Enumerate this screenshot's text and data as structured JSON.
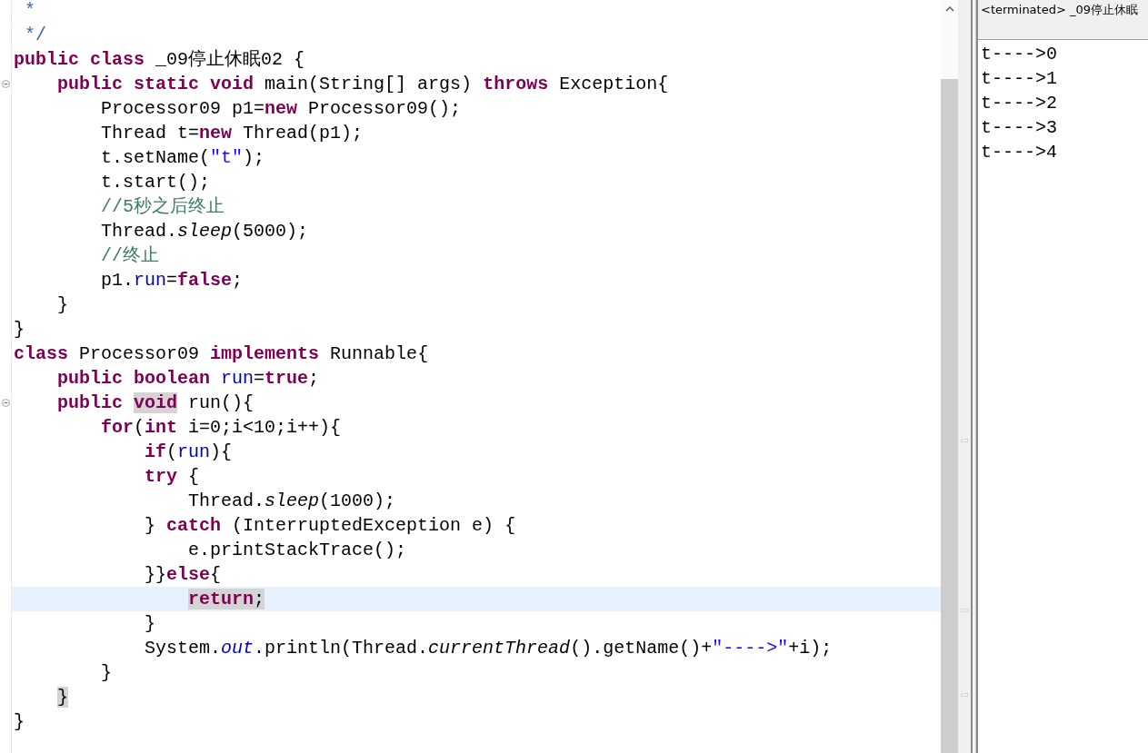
{
  "editor": {
    "lines": [
      {
        "fold_marker": false,
        "current": false,
        "tokens": [
          {
            "kind": "javadoc",
            "text": " *"
          }
        ]
      },
      {
        "fold_marker": false,
        "current": false,
        "tokens": [
          {
            "kind": "javadoc",
            "text": " */"
          }
        ]
      },
      {
        "fold_marker": false,
        "current": false,
        "tokens": [
          {
            "kind": "keyword",
            "text": "public class"
          },
          {
            "kind": "plain",
            "text": " _09停止休眠02 {"
          }
        ]
      },
      {
        "fold_marker": true,
        "current": false,
        "tokens": [
          {
            "kind": "keyword",
            "text": "    public static void"
          },
          {
            "kind": "plain",
            "text": " main(String[] args) "
          },
          {
            "kind": "keyword",
            "text": "throws"
          },
          {
            "kind": "plain",
            "text": " Exception{"
          }
        ]
      },
      {
        "fold_marker": false,
        "current": false,
        "tokens": [
          {
            "kind": "plain",
            "text": "        Processor09 p1="
          },
          {
            "kind": "keyword",
            "text": "new"
          },
          {
            "kind": "plain",
            "text": " Processor09();"
          }
        ]
      },
      {
        "fold_marker": false,
        "current": false,
        "tokens": [
          {
            "kind": "plain",
            "text": "        Thread t="
          },
          {
            "kind": "keyword",
            "text": "new"
          },
          {
            "kind": "plain",
            "text": " Thread(p1);"
          }
        ]
      },
      {
        "fold_marker": false,
        "current": false,
        "tokens": [
          {
            "kind": "plain",
            "text": "        t.setName("
          },
          {
            "kind": "string",
            "text": "\"t\""
          },
          {
            "kind": "plain",
            "text": ");"
          }
        ]
      },
      {
        "fold_marker": false,
        "current": false,
        "tokens": [
          {
            "kind": "plain",
            "text": "        t.start();"
          }
        ]
      },
      {
        "fold_marker": false,
        "current": false,
        "tokens": [
          {
            "kind": "comment",
            "text": "        //5秒之后终止"
          }
        ]
      },
      {
        "fold_marker": false,
        "current": false,
        "tokens": [
          {
            "kind": "plain",
            "text": "        Thread."
          },
          {
            "kind": "static-method",
            "text": "sleep"
          },
          {
            "kind": "plain",
            "text": "(5000);"
          }
        ]
      },
      {
        "fold_marker": false,
        "current": false,
        "tokens": [
          {
            "kind": "comment",
            "text": "        //终止"
          }
        ]
      },
      {
        "fold_marker": false,
        "current": false,
        "tokens": [
          {
            "kind": "plain",
            "text": "        p1."
          },
          {
            "kind": "field",
            "text": "run"
          },
          {
            "kind": "plain",
            "text": "="
          },
          {
            "kind": "keyword",
            "text": "false"
          },
          {
            "kind": "plain",
            "text": ";"
          }
        ]
      },
      {
        "fold_marker": false,
        "current": false,
        "tokens": [
          {
            "kind": "plain",
            "text": "    }"
          }
        ]
      },
      {
        "fold_marker": false,
        "current": false,
        "tokens": [
          {
            "kind": "plain",
            "text": "}"
          }
        ]
      },
      {
        "fold_marker": false,
        "current": false,
        "tokens": [
          {
            "kind": "keyword",
            "text": "class"
          },
          {
            "kind": "plain",
            "text": " Processor09 "
          },
          {
            "kind": "keyword",
            "text": "implements"
          },
          {
            "kind": "plain",
            "text": " Runnable{"
          }
        ]
      },
      {
        "fold_marker": false,
        "current": false,
        "tokens": [
          {
            "kind": "keyword",
            "text": "    public boolean "
          },
          {
            "kind": "field",
            "text": "run"
          },
          {
            "kind": "plain",
            "text": "="
          },
          {
            "kind": "keyword",
            "text": "true"
          },
          {
            "kind": "plain",
            "text": ";"
          }
        ]
      },
      {
        "fold_marker": true,
        "current": false,
        "tokens": [
          {
            "kind": "keyword",
            "text": "    public "
          },
          {
            "kind": "marked-keyword",
            "text": "void"
          },
          {
            "kind": "plain",
            "text": " run(){"
          }
        ]
      },
      {
        "fold_marker": false,
        "current": false,
        "tokens": [
          {
            "kind": "keyword",
            "text": "        for"
          },
          {
            "kind": "plain",
            "text": "("
          },
          {
            "kind": "keyword",
            "text": "int"
          },
          {
            "kind": "plain",
            "text": " i=0;i<10;i++){"
          }
        ]
      },
      {
        "fold_marker": false,
        "current": false,
        "tokens": [
          {
            "kind": "keyword",
            "text": "            if"
          },
          {
            "kind": "plain",
            "text": "("
          },
          {
            "kind": "field",
            "text": "run"
          },
          {
            "kind": "plain",
            "text": "){"
          }
        ]
      },
      {
        "fold_marker": false,
        "current": false,
        "tokens": [
          {
            "kind": "keyword",
            "text": "            try"
          },
          {
            "kind": "plain",
            "text": " {"
          }
        ]
      },
      {
        "fold_marker": false,
        "current": false,
        "tokens": [
          {
            "kind": "plain",
            "text": "                Thread."
          },
          {
            "kind": "static-method",
            "text": "sleep"
          },
          {
            "kind": "plain",
            "text": "(1000);"
          }
        ]
      },
      {
        "fold_marker": false,
        "current": false,
        "tokens": [
          {
            "kind": "plain",
            "text": "            } "
          },
          {
            "kind": "keyword",
            "text": "catch"
          },
          {
            "kind": "plain",
            "text": " (InterruptedException e) {"
          }
        ]
      },
      {
        "fold_marker": false,
        "current": false,
        "tokens": [
          {
            "kind": "plain",
            "text": "                e.printStackTrace();"
          }
        ]
      },
      {
        "fold_marker": false,
        "current": false,
        "tokens": [
          {
            "kind": "plain",
            "text": "            }}"
          },
          {
            "kind": "keyword",
            "text": "else"
          },
          {
            "kind": "plain",
            "text": "{"
          }
        ]
      },
      {
        "fold_marker": false,
        "current": true,
        "tokens": [
          {
            "kind": "marked-keyword",
            "text": "                return"
          },
          {
            "kind": "marked-plain",
            "text": ";"
          }
        ]
      },
      {
        "fold_marker": false,
        "current": false,
        "tokens": [
          {
            "kind": "plain",
            "text": "            }"
          }
        ]
      },
      {
        "fold_marker": false,
        "current": false,
        "tokens": [
          {
            "kind": "plain",
            "text": "            System."
          },
          {
            "kind": "static-field",
            "text": "out"
          },
          {
            "kind": "plain",
            "text": ".println(Thread."
          },
          {
            "kind": "static-method",
            "text": "currentThread"
          },
          {
            "kind": "plain",
            "text": "().getName()+"
          },
          {
            "kind": "string",
            "text": "\"---->\""
          },
          {
            "kind": "plain",
            "text": "+i);"
          }
        ]
      },
      {
        "fold_marker": false,
        "current": false,
        "tokens": [
          {
            "kind": "plain",
            "text": "        }"
          }
        ]
      },
      {
        "fold_marker": false,
        "current": false,
        "tokens": [
          {
            "kind": "marked-plain",
            "text": "    }"
          }
        ]
      },
      {
        "fold_marker": false,
        "current": false,
        "tokens": [
          {
            "kind": "plain",
            "text": "}"
          }
        ]
      }
    ]
  },
  "console": {
    "title": "<terminated> _09停止休眠",
    "output": [
      "t---->0",
      "t---->1",
      "t---->2",
      "t---->3",
      "t---->4"
    ]
  }
}
